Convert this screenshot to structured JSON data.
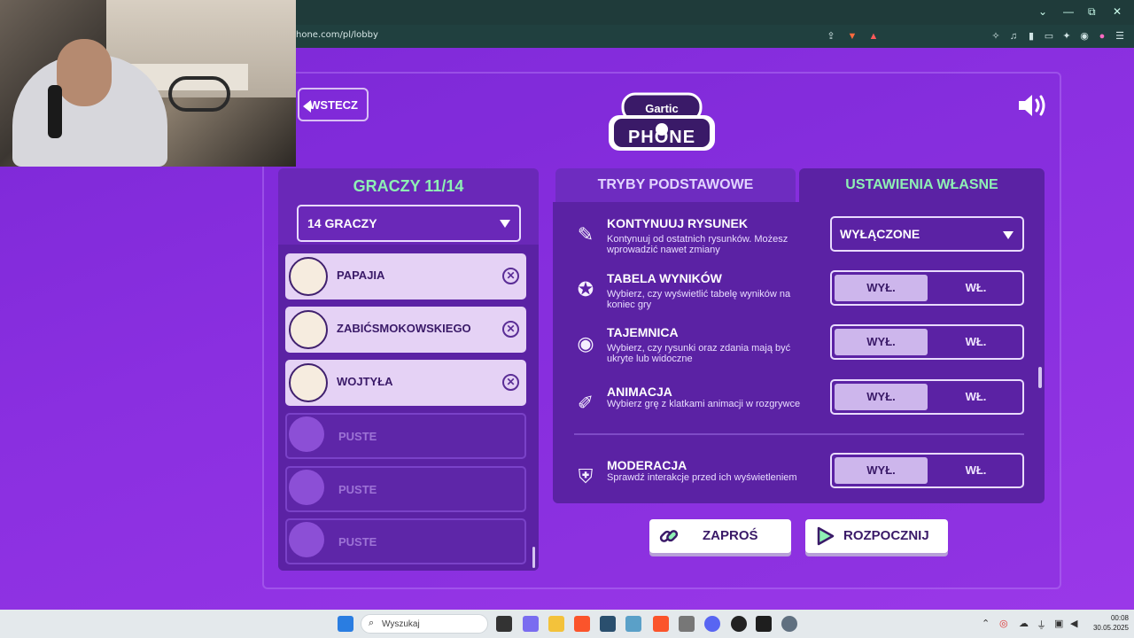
{
  "browser": {
    "url": "hone.com/pl/lobby",
    "window_controls": [
      "⌄",
      "—",
      "⧉",
      "✕"
    ]
  },
  "game": {
    "back_label": "WSTECZ",
    "logo_top": "Gartic",
    "logo_bottom": "PHONE"
  },
  "players": {
    "title": "GRACZY 11/14",
    "count_selected": "14 GRACZY",
    "list": [
      {
        "name": "PAPAJIA",
        "state": "filled"
      },
      {
        "name": "ZABIĆSMOKOWSKIEGO",
        "state": "filled"
      },
      {
        "name": "WOJTYŁA",
        "state": "filled"
      },
      {
        "name": "PUSTE",
        "state": "empty"
      },
      {
        "name": "PUSTE",
        "state": "empty"
      },
      {
        "name": "PUSTE",
        "state": "empty"
      }
    ]
  },
  "tabs": {
    "basic": "TRYBY PODSTAWOWE",
    "custom": "USTAWIENIA WŁASNE"
  },
  "settings": [
    {
      "title": "KONTYNUUJ RYSUNEK",
      "desc": "Kontynuuj od ostatnich rysunków. Możesz wprowadzić nawet zmiany",
      "control": "dropdown",
      "value": "WYŁĄCZONE"
    },
    {
      "title": "TABELA WYNIKÓW",
      "desc": "Wybierz, czy wyświetlić tabelę wyników na koniec gry",
      "off": "WYŁ.",
      "on": "WŁ."
    },
    {
      "title": "TAJEMNICA",
      "desc": "Wybierz, czy rysunki oraz zdania mają być ukryte lub widoczne",
      "off": "WYŁ.",
      "on": "WŁ."
    },
    {
      "title": "ANIMACJA",
      "desc": "Wybierz grę z klatkami animacji w rozgrywce",
      "off": "WYŁ.",
      "on": "WŁ."
    },
    {
      "title": "MODERACJA",
      "desc": "Sprawdź interakcje przed ich wyświetleniem",
      "off": "WYŁ.",
      "on": "WŁ."
    }
  ],
  "actions": {
    "invite": "ZAPROŚ",
    "start": "ROZPOCZNIJ"
  },
  "taskbar": {
    "search_placeholder": "Wyszukaj",
    "time": "00:08",
    "date": "30.05.2025"
  },
  "colors": {
    "accent_green": "#8ef0b4",
    "purple_bg": "#8a2be2",
    "panel": "#5b22a4"
  }
}
